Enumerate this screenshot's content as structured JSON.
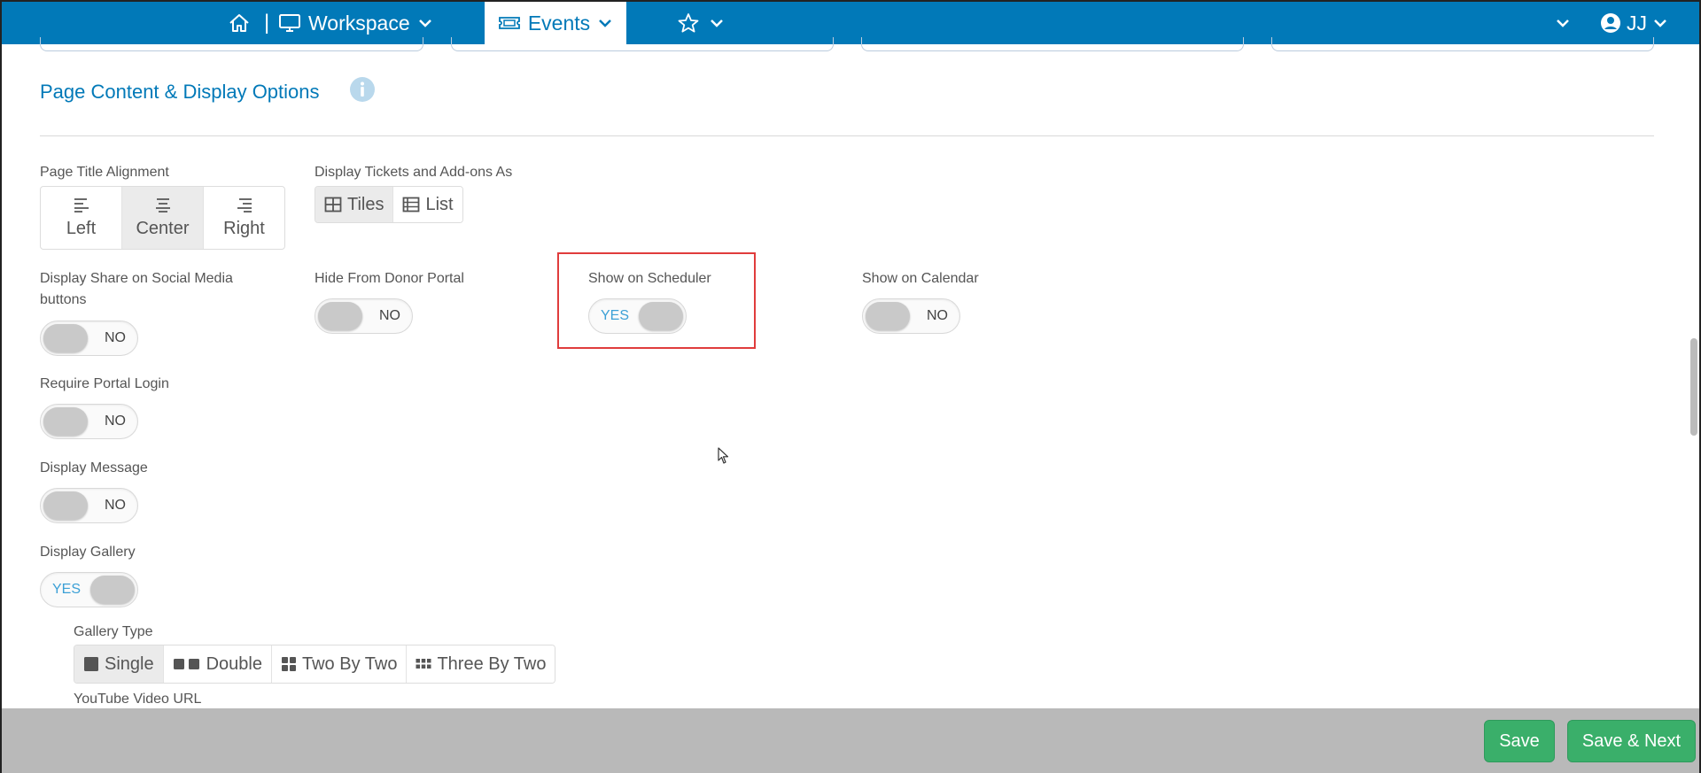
{
  "nav": {
    "separator": "|",
    "workspace": "Workspace",
    "events": "Events",
    "user": "JJ"
  },
  "section": {
    "title": "Page Content & Display Options"
  },
  "page_title_alignment": {
    "label": "Page Title Alignment",
    "options": [
      "Left",
      "Center",
      "Right"
    ],
    "selected": "Center"
  },
  "display_tickets": {
    "label": "Display Tickets and Add-ons As",
    "options": [
      "Tiles",
      "List"
    ],
    "selected": "Tiles"
  },
  "toggles": {
    "share_social": {
      "label": "Display Share on Social Media buttons",
      "state": "NO"
    },
    "hide_donor_portal": {
      "label": "Hide From Donor Portal",
      "state": "NO"
    },
    "show_scheduler": {
      "label": "Show on Scheduler",
      "state": "YES"
    },
    "show_calendar": {
      "label": "Show on Calendar",
      "state": "NO"
    },
    "require_login": {
      "label": "Require Portal Login",
      "state": "NO"
    },
    "display_message": {
      "label": "Display Message",
      "state": "NO"
    },
    "display_gallery": {
      "label": "Display Gallery",
      "state": "YES"
    }
  },
  "gallery_type": {
    "label": "Gallery Type",
    "options": [
      "Single",
      "Double",
      "Two By Two",
      "Three By Two"
    ],
    "selected": "Single"
  },
  "youtube_label": "YouTube Video URL",
  "footer": {
    "save": "Save",
    "save_next": "Save & Next"
  },
  "colors": {
    "brand": "#0179b8",
    "success": "#3aaf6a",
    "highlight": "#e03c3c",
    "toggle_on_text": "#3ca0d6"
  }
}
